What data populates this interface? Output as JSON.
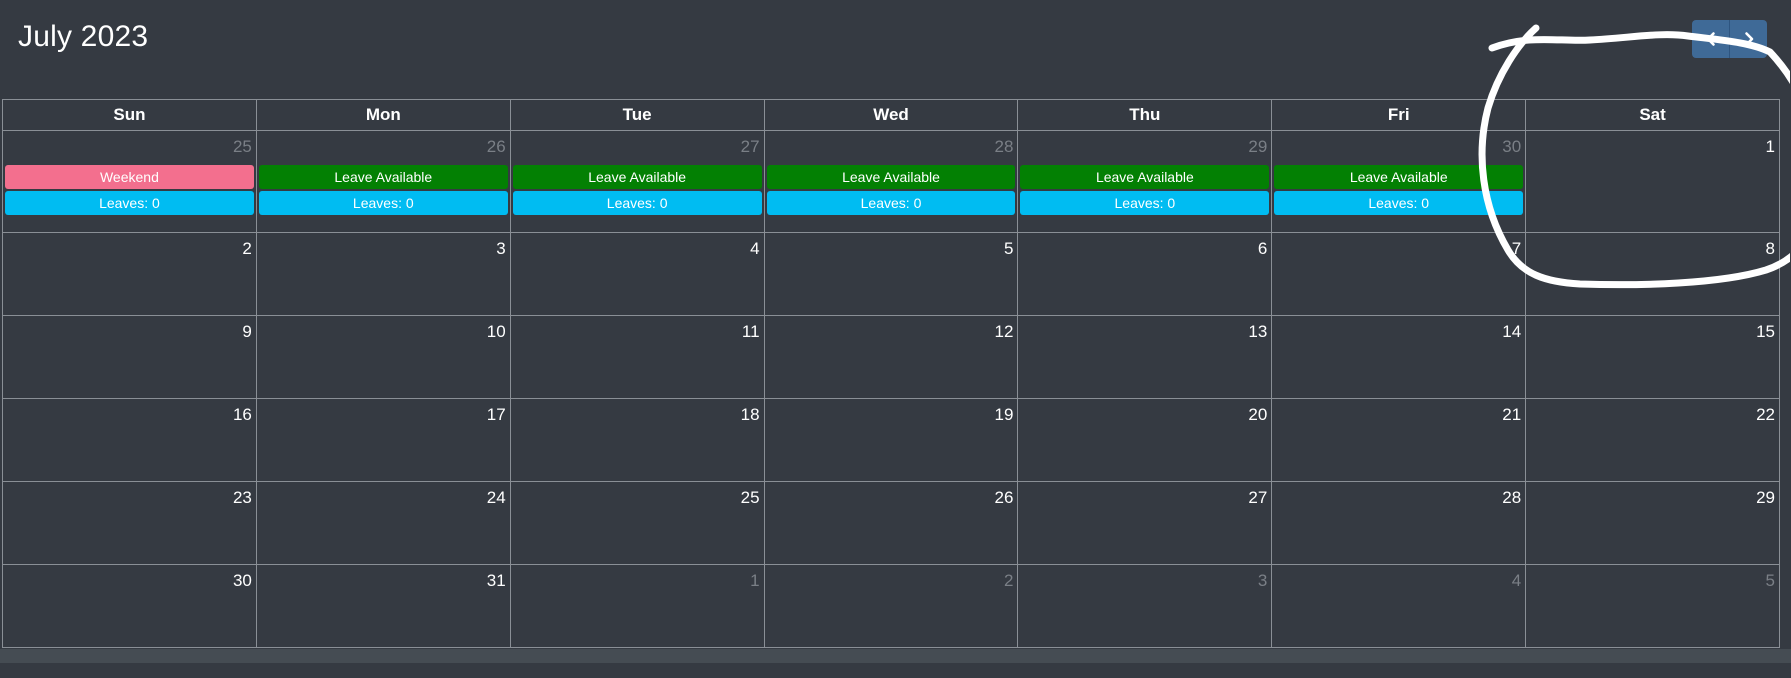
{
  "calendar": {
    "title": "July 2023",
    "weekdays": [
      "Sun",
      "Mon",
      "Tue",
      "Wed",
      "Thu",
      "Fri",
      "Sat"
    ],
    "weeks": [
      [
        {
          "day": "25",
          "other": true,
          "status": "Weekend",
          "status_color": "#f36f8e",
          "leaves": "Leaves: 0"
        },
        {
          "day": "26",
          "other": true,
          "status": "Leave Available",
          "status_color": "#038003",
          "leaves": "Leaves: 0"
        },
        {
          "day": "27",
          "other": true,
          "status": "Leave Available",
          "status_color": "#038003",
          "leaves": "Leaves: 0"
        },
        {
          "day": "28",
          "other": true,
          "status": "Leave Available",
          "status_color": "#038003",
          "leaves": "Leaves: 0"
        },
        {
          "day": "29",
          "other": true,
          "status": "Leave Available",
          "status_color": "#038003",
          "leaves": "Leaves: 0"
        },
        {
          "day": "30",
          "other": true,
          "status": "Leave Available",
          "status_color": "#038003",
          "leaves": "Leaves: 0"
        },
        {
          "day": "1",
          "other": false
        }
      ],
      [
        {
          "day": "2",
          "other": false
        },
        {
          "day": "3",
          "other": false
        },
        {
          "day": "4",
          "other": false
        },
        {
          "day": "5",
          "other": false
        },
        {
          "day": "6",
          "other": false
        },
        {
          "day": "7",
          "other": false
        },
        {
          "day": "8",
          "other": false
        }
      ],
      [
        {
          "day": "9",
          "other": false
        },
        {
          "day": "10",
          "other": false
        },
        {
          "day": "11",
          "other": false
        },
        {
          "day": "12",
          "other": false
        },
        {
          "day": "13",
          "other": false
        },
        {
          "day": "14",
          "other": false
        },
        {
          "day": "15",
          "other": false
        }
      ],
      [
        {
          "day": "16",
          "other": false
        },
        {
          "day": "17",
          "other": false
        },
        {
          "day": "18",
          "other": false
        },
        {
          "day": "19",
          "other": false
        },
        {
          "day": "20",
          "other": false
        },
        {
          "day": "21",
          "other": false
        },
        {
          "day": "22",
          "other": false
        }
      ],
      [
        {
          "day": "23",
          "other": false
        },
        {
          "day": "24",
          "other": false
        },
        {
          "day": "25",
          "other": false
        },
        {
          "day": "26",
          "other": false
        },
        {
          "day": "27",
          "other": false
        },
        {
          "day": "28",
          "other": false
        },
        {
          "day": "29",
          "other": false
        }
      ],
      [
        {
          "day": "30",
          "other": false
        },
        {
          "day": "31",
          "other": false
        },
        {
          "day": "1",
          "other": true
        },
        {
          "day": "2",
          "other": true
        },
        {
          "day": "3",
          "other": true
        },
        {
          "day": "4",
          "other": true
        },
        {
          "day": "5",
          "other": true
        }
      ]
    ]
  },
  "nav": {
    "prev_icon": "chevron-left-icon",
    "next_icon": "chevron-right-icon",
    "button_color": "#3f6a97"
  },
  "colors": {
    "background": "#353a42",
    "leaves_badge": "#00bcf2",
    "weekend": "#f36f8e",
    "available": "#038003"
  }
}
